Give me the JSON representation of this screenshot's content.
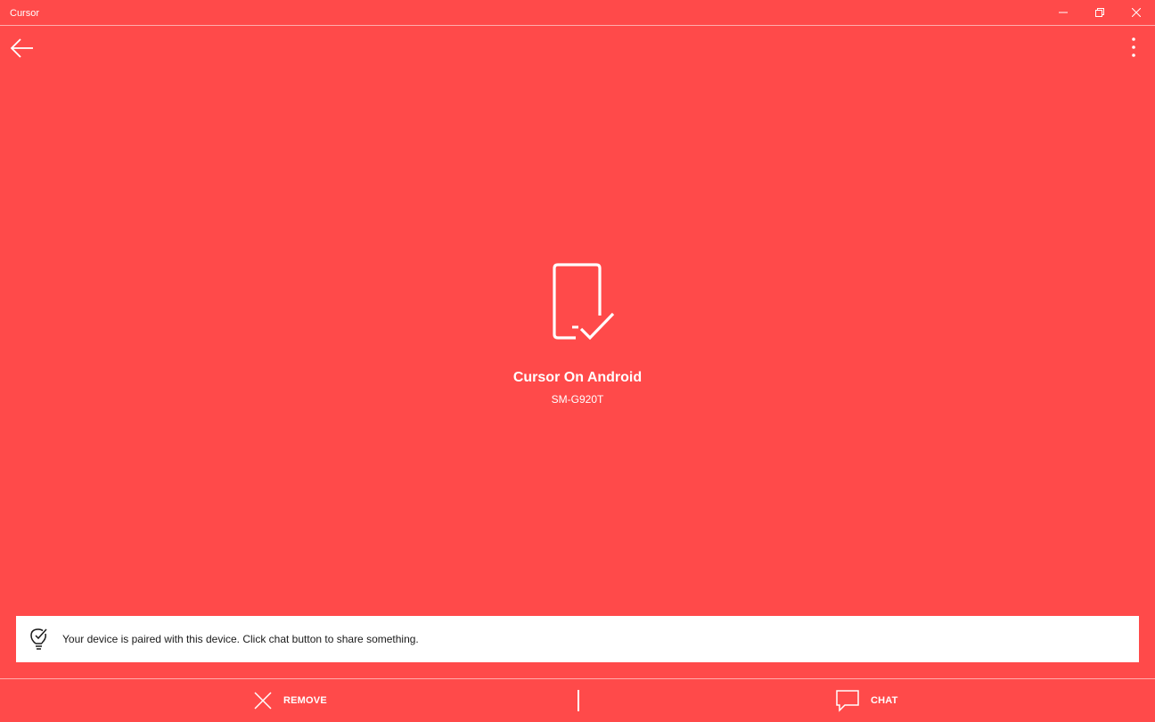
{
  "window": {
    "title": "Cursor",
    "minimize_icon": "minimize-icon",
    "restore_icon": "restore-icon",
    "close_icon": "close-icon"
  },
  "toolbar": {
    "back_icon": "back-arrow-icon",
    "more_icon": "more-vertical-icon"
  },
  "device": {
    "icon": "phone-check-icon",
    "name": "Cursor On Android",
    "model": "SM-G920T"
  },
  "info": {
    "icon": "lightbulb-check-icon",
    "message": "Your device is paired with this device. Click chat button to share something."
  },
  "commands": {
    "remove_label": "REMOVE",
    "remove_icon": "close-x-icon",
    "chat_label": "CHAT",
    "chat_icon": "chat-bubble-icon"
  },
  "colors": {
    "background": "#FF4A4A",
    "foreground": "#FFFFFF",
    "info_background": "#FFFFFF"
  }
}
